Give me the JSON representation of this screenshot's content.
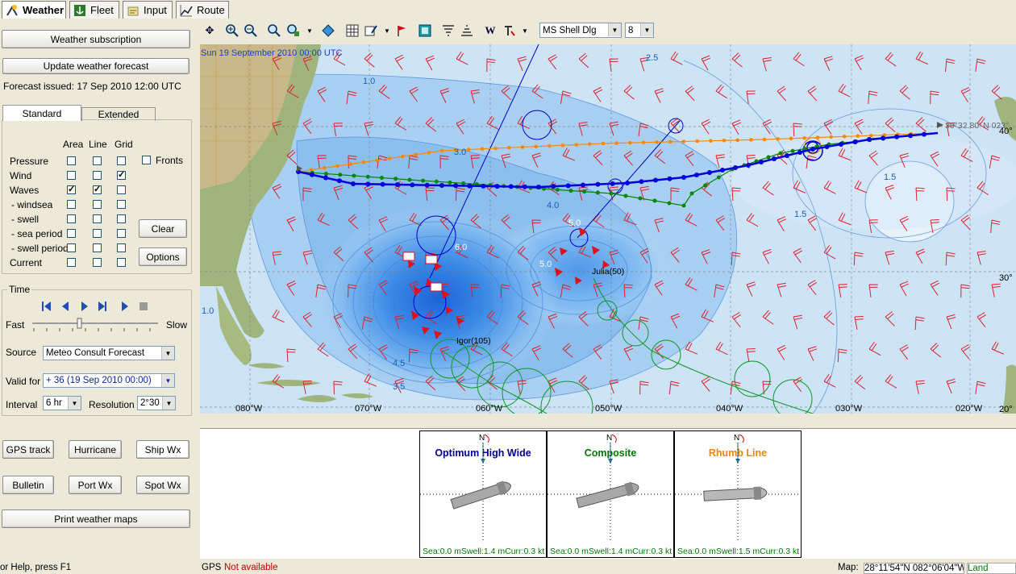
{
  "top_tabs": [
    {
      "label": "Weather",
      "icon": "weather-icon",
      "active": true
    },
    {
      "label": "Fleet",
      "icon": "fleet-icon",
      "active": false
    },
    {
      "label": "Input",
      "icon": "input-icon",
      "active": false
    },
    {
      "label": "Route",
      "icon": "route-icon",
      "active": false
    }
  ],
  "left": {
    "weather_subscription": "Weather subscription",
    "update_forecast": "Update weather forecast",
    "forecast_issued": "Forecast issued:  17 Sep 2010 12:00 UTC",
    "tabs": [
      "Standard",
      "Extended"
    ],
    "cols": [
      "Area",
      "Line",
      "Grid"
    ],
    "fronts": "Fronts",
    "rows": [
      "Pressure",
      "Wind",
      "Waves",
      "- windsea",
      "- swell",
      "- sea period",
      "- swell period",
      "Current"
    ],
    "clear": "Clear",
    "options": "Options",
    "time_label": "Time",
    "fast": "Fast",
    "slow": "Slow",
    "source_label": "Source",
    "source_value": "Meteo Consult Forecast",
    "valid_label": "Valid for",
    "valid_value": "+ 36 (19 Sep 2010 00:00)",
    "interval_label": "Interval",
    "interval_value": "6 hr",
    "resolution_label": "Resolution",
    "resolution_value": "2°30",
    "buttons": [
      "GPS track",
      "Hurricane",
      "Ship Wx",
      "Bulletin",
      "Port Wx",
      "Spot Wx"
    ],
    "print": "Print weather maps"
  },
  "toolbar": {
    "font_value": "MS Shell Dlg",
    "size_value": "8"
  },
  "map": {
    "date_label": "Sun 19 September 2010 00:00 UTC",
    "lon_labels": [
      "080°W",
      "070°W",
      "060°W",
      "050°W",
      "040°W",
      "030°W",
      "020°W"
    ],
    "lat_labels": [
      "40°",
      "30°",
      "20°"
    ],
    "contour_labels": [
      "2.5",
      "3.0",
      "4.0",
      "5.0",
      "5.0",
      "6.0",
      "3.5",
      "4.5",
      "1.5",
      "1.5",
      "1.0",
      "1.0"
    ],
    "storms": [
      "Igor(105)",
      "Julia(50)"
    ],
    "endpoint_label": "39°32.80' N 023°",
    "colors": {
      "blue_route": "#0000dd",
      "green_route": "#008800",
      "orange_route": "#ff8800",
      "barb": "#e0202a"
    }
  },
  "polar": [
    {
      "title": "Optimum High Wide",
      "color": "#000099",
      "footer": "Sea:0.0 mSwell:1.4 mCurr:0.3 kt"
    },
    {
      "title": "Composite",
      "color": "#007a00",
      "footer": "Sea:0.0 mSwell:1.4 mCurr:0.3 kt"
    },
    {
      "title": "Rhumb Line",
      "color": "#e8880a",
      "footer": "Sea:0.0 mSwell:1.5 mCurr:0.3 kt"
    }
  ],
  "status": {
    "help": "or Help, press F1",
    "gps_label": "GPS",
    "gps_value": "Not available",
    "map_label": "Map:",
    "map_coord": "28°11'54\"N 082°06'04\"W",
    "land": "Land"
  }
}
